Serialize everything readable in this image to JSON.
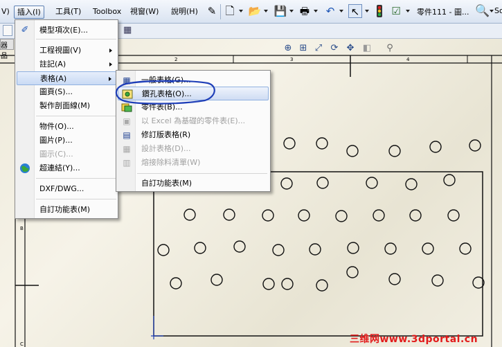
{
  "menubar": {
    "items": [
      {
        "label": "V)"
      },
      {
        "label": "插入(I)"
      },
      {
        "label": "工具(T)"
      },
      {
        "label": "Toolbox"
      },
      {
        "label": "視窗(W)"
      },
      {
        "label": "說明(H)"
      }
    ],
    "doc_title": "零件111 - 圖...",
    "search_text": "So"
  },
  "left_tab": "器品",
  "insert_menu": {
    "items": [
      {
        "label": "模型項次(E)...",
        "icon": "model-items-icon",
        "submenu": false,
        "disabled": false
      },
      {
        "label": "工程視圖(V)",
        "submenu": true,
        "disabled": false
      },
      {
        "label": "註記(A)",
        "submenu": true,
        "disabled": false
      },
      {
        "label": "表格(A)",
        "submenu": true,
        "disabled": false,
        "highlighted": true
      },
      {
        "label": "圖頁(S)...",
        "submenu": false,
        "disabled": false
      },
      {
        "label": "製作剖面線(M)",
        "submenu": false,
        "disabled": false
      },
      {
        "label": "物件(O)...",
        "submenu": false,
        "disabled": false
      },
      {
        "label": "圖片(P)...",
        "submenu": false,
        "disabled": false
      },
      {
        "label": "圖示(C)...",
        "submenu": false,
        "disabled": true
      },
      {
        "label": "超連結(Y)...",
        "icon": "hyperlink-globe-icon",
        "submenu": false,
        "disabled": false
      },
      {
        "label": "DXF/DWG...",
        "submenu": false,
        "disabled": false
      },
      {
        "label": "自訂功能表(M)",
        "submenu": false,
        "disabled": false
      }
    ]
  },
  "table_submenu": {
    "items": [
      {
        "label": "一般表格(G)...",
        "icon": "general-table-icon",
        "disabled": false
      },
      {
        "label": "鑽孔表格(O)...",
        "icon": "hole-table-icon",
        "disabled": false,
        "highlighted": true
      },
      {
        "label": "零件表(B)...",
        "icon": "bom-icon",
        "disabled": false
      },
      {
        "label": "以 Excel 為基礎的零件表(E)...",
        "icon": "excel-bom-icon",
        "disabled": true
      },
      {
        "label": "修訂版表格(R)",
        "icon": "revision-table-icon",
        "disabled": false
      },
      {
        "label": "設計表格(D)...",
        "icon": "design-table-icon",
        "disabled": true
      },
      {
        "label": "熔接除料清單(W)",
        "icon": "weldment-cutlist-icon",
        "disabled": true
      },
      {
        "label": "自訂功能表(M)",
        "disabled": false
      }
    ]
  },
  "sheet": {
    "zone_labels": [
      "2",
      "3",
      "4",
      "B",
      "C"
    ]
  },
  "watermark": "三维网www.3dportal.cn",
  "colors": {
    "annotation_circle": "#1f3fb8",
    "watermark": "#e21b1b",
    "menu_highlight": "#c9daf4"
  }
}
